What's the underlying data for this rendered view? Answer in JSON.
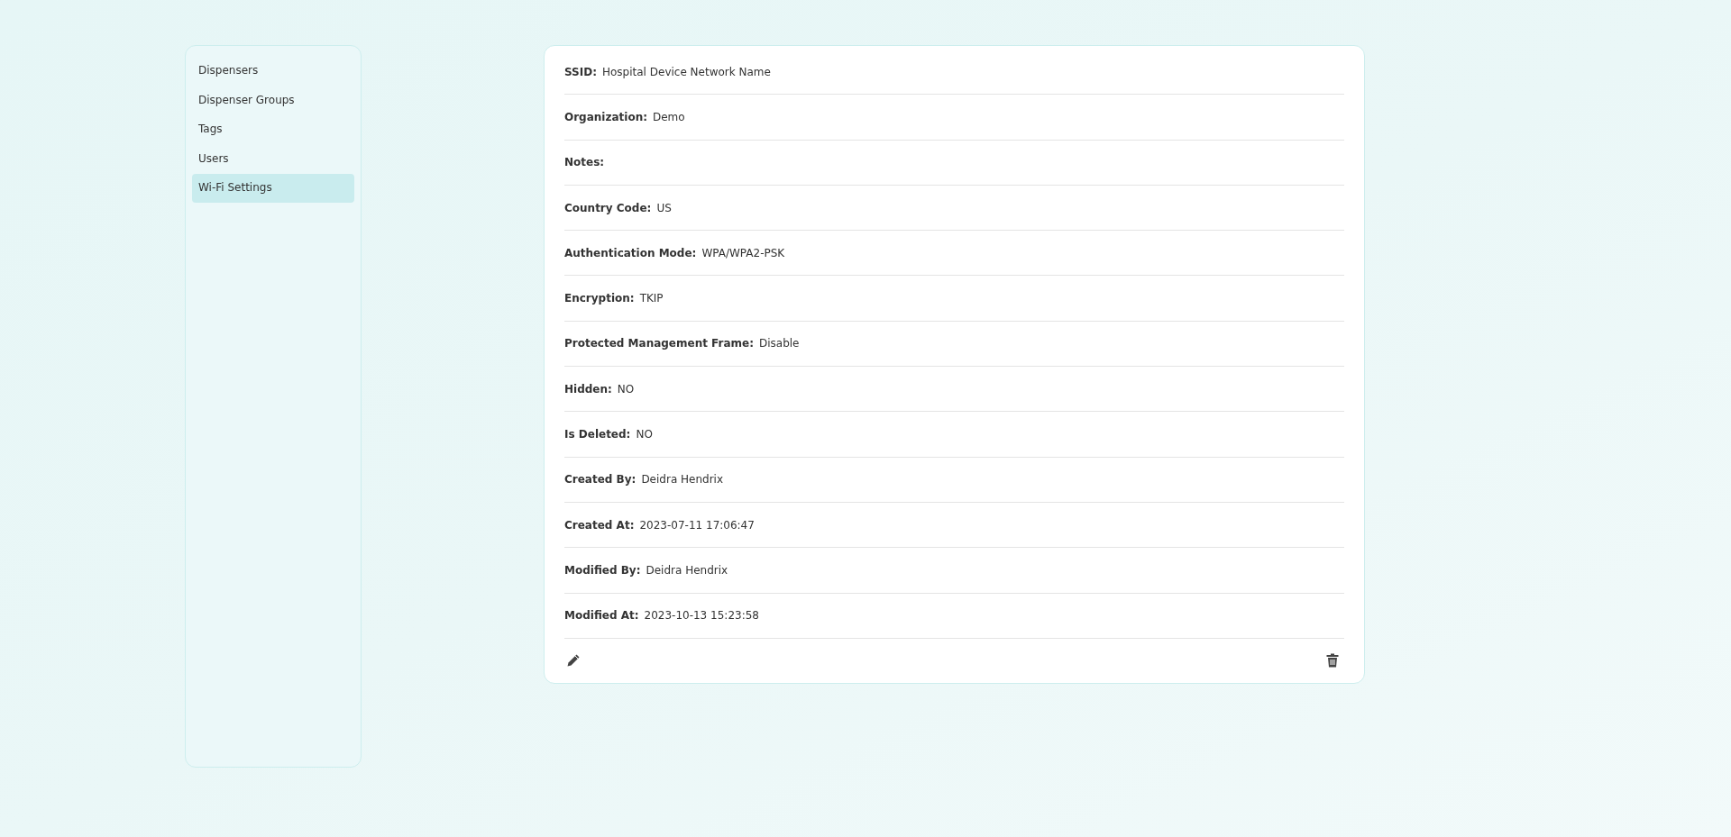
{
  "sidebar": {
    "items": [
      {
        "label": "Dispensers",
        "selected": false
      },
      {
        "label": "Dispenser Groups",
        "selected": false
      },
      {
        "label": "Tags",
        "selected": false
      },
      {
        "label": "Users",
        "selected": false
      },
      {
        "label": "Wi-Fi Settings",
        "selected": true
      }
    ]
  },
  "details": {
    "fields": [
      {
        "label": "SSID:",
        "value": "Hospital Device Network Name"
      },
      {
        "label": "Organization:",
        "value": "Demo"
      },
      {
        "label": "Notes:"
      },
      {
        "label": "Country Code:",
        "value": "US"
      },
      {
        "label": "Authentication Mode:",
        "value": "WPA/WPA2-PSK"
      },
      {
        "label": "Encryption:",
        "value": "TKIP"
      },
      {
        "label": "Protected Management Frame:",
        "value": "Disable"
      },
      {
        "label": "Hidden:",
        "value": "NO"
      },
      {
        "label": "Is Deleted:",
        "value": "NO"
      },
      {
        "label": "Created By:",
        "value": "Deidra Hendrix"
      },
      {
        "label": "Created At:",
        "value": "2023-07-11 17:06:47"
      },
      {
        "label": "Modified By:",
        "value": "Deidra Hendrix"
      },
      {
        "label": "Modified At:",
        "value": "2023-10-13 15:23:58"
      }
    ]
  }
}
